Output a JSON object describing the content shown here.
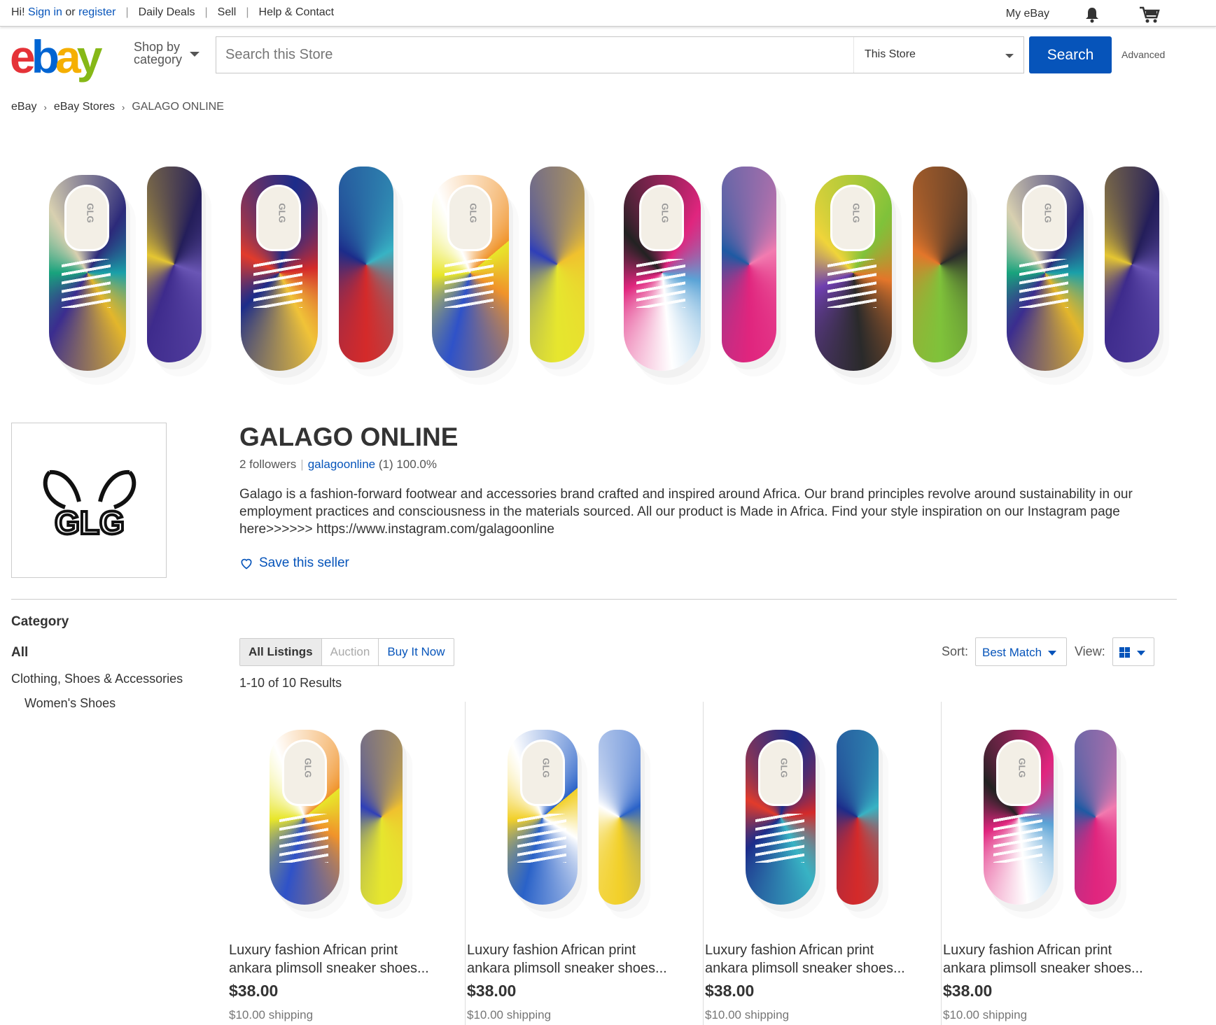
{
  "topbar": {
    "greeting": "Hi!",
    "sign_in": "Sign in",
    "or": "or",
    "register": "register",
    "links": [
      "Daily Deals",
      "Sell",
      "Help & Contact"
    ],
    "my_ebay": "My eBay"
  },
  "header": {
    "logo": {
      "e": "e",
      "b": "b",
      "a": "a",
      "y": "y"
    },
    "shop_by_line1": "Shop by",
    "shop_by_line2": "category",
    "search_placeholder": "Search this Store",
    "search_scope": "This Store",
    "search_button": "Search",
    "advanced": "Advanced"
  },
  "breadcrumb": [
    "eBay",
    "eBay Stores",
    "GALAGO ONLINE"
  ],
  "store": {
    "name": "GALAGO ONLINE",
    "followers": "2 followers",
    "seller_id": "galagoonline",
    "feedback": "(1) 100.0%",
    "description": "Galago is a fashion-forward footwear and accessories brand crafted and inspired around Africa. Our brand principles revolve around sustainability in our employment practices and consciousness in the materials sourced. All our product is Made in Africa. Find your style inspiration on our Instagram page here>>>>>> https://www.instagram.com/galagoonline",
    "save_seller": "Save this seller",
    "logo_text": "GLG"
  },
  "sidebar": {
    "heading": "Category",
    "all": "All",
    "category": "Clothing, Shoes & Accessories",
    "subcategory": "Women's Shoes"
  },
  "listing_tabs": [
    "All Listings",
    "Auction",
    "Buy It Now"
  ],
  "results": "1-10 of 10 Results",
  "sort": {
    "label": "Sort:",
    "value": "Best Match"
  },
  "view": {
    "label": "View:"
  },
  "products": [
    {
      "title_line1": "Luxury fashion African print",
      "title_line2": "ankara plimsoll sneaker shoes...",
      "price": "$38.00",
      "shipping": "$10.00 shipping"
    },
    {
      "title_line1": "Luxury fashion African print",
      "title_line2": "ankara plimsoll sneaker shoes...",
      "price": "$38.00",
      "shipping": "$10.00 shipping"
    },
    {
      "title_line1": "Luxury fashion African print",
      "title_line2": "ankara plimsoll sneaker shoes...",
      "price": "$38.00",
      "shipping": "$10.00 shipping"
    },
    {
      "title_line1": "Luxury fashion African print",
      "title_line2": "ankara plimsoll sneaker shoes...",
      "price": "$38.00",
      "shipping": "$10.00 shipping"
    }
  ],
  "colors": {
    "link_blue": "#0654ba",
    "logo_red": "#e53238",
    "logo_blue": "#0064d2",
    "logo_yellow": "#f5af02",
    "logo_green": "#86b817"
  }
}
